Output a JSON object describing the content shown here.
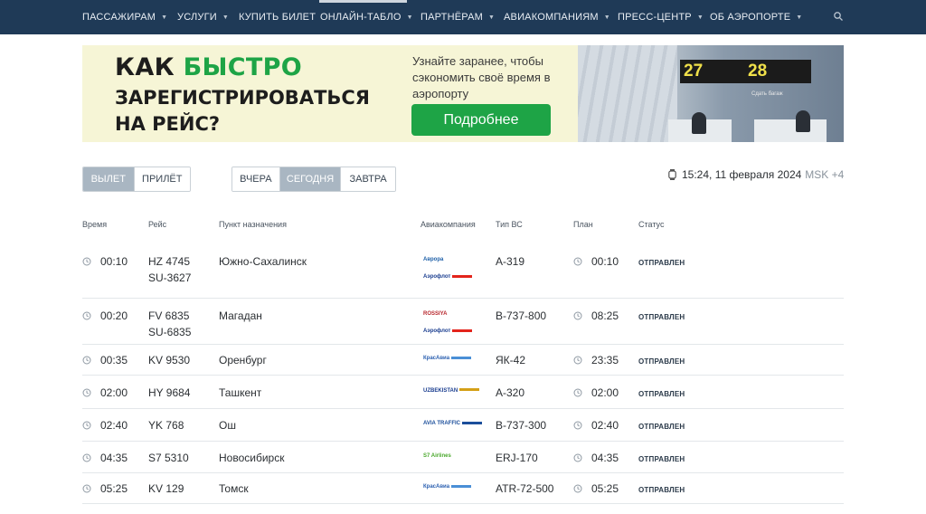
{
  "nav": {
    "items": [
      {
        "label": "ПАССАЖИРАМ",
        "caret": true
      },
      {
        "label": "УСЛУГИ",
        "caret": true
      },
      {
        "label": "КУПИТЬ БИЛЕТ",
        "caret": false
      },
      {
        "label": "ОНЛАЙН-ТАБЛО",
        "caret": true
      },
      {
        "label": "ПАРТНЁРАМ",
        "caret": true
      },
      {
        "label": "АВИАКОМПАНИЯМ",
        "caret": true
      },
      {
        "label": "ПРЕСС-ЦЕНТР",
        "caret": true
      },
      {
        "label": "ОБ АЭРОПОРТЕ",
        "caret": true
      }
    ],
    "search_icon": "search-icon"
  },
  "banner": {
    "title_part1": "КАК",
    "title_part2": "БЫСТРО",
    "title_line2": "ЗАРЕГИСТРИРОВАТЬСЯ",
    "title_line3": "НА РЕЙС?",
    "subtitle": "Узнайте заранее, чтобы сэкономить своё время в аэропорту",
    "button": "Подробнее",
    "sign1_number": "27",
    "sign2_number": "28",
    "sign2_text": "Сдать багаж",
    "accent_color": "#1ea446"
  },
  "filters": {
    "direction": [
      {
        "label": "ВЫЛЕТ",
        "active": true
      },
      {
        "label": "ПРИЛЁТ",
        "active": false
      }
    ],
    "day": [
      {
        "label": "ВЧЕРА",
        "active": false
      },
      {
        "label": "СЕГОДНЯ",
        "active": true
      },
      {
        "label": "ЗАВТРА",
        "active": false
      }
    ]
  },
  "clock": {
    "datetime": "15:24, 11 февраля 2024",
    "tz": "MSK +4"
  },
  "table": {
    "headers": [
      "Время",
      "Рейс",
      "Пункт назначения",
      "Авиакомпания",
      "Тип ВС",
      "План",
      "Статус"
    ],
    "rows": [
      {
        "time": "00:10",
        "flight": "HZ 4745",
        "flight2": "SU-3627",
        "destination": "Южно-Сахалинск",
        "airline": "Аврора",
        "airline2": "Аэрофлот",
        "aircraft": "A-319",
        "plan": "00:10",
        "status": "ОТПРАВЛЕН"
      },
      {
        "time": "00:20",
        "flight": "FV 6835",
        "flight2": "SU-6835",
        "destination": "Магадан",
        "airline": "ROSSIYA",
        "airline2": "Аэрофлот",
        "aircraft": "B-737-800",
        "plan": "08:25",
        "status": "ОТПРАВЛЕН"
      },
      {
        "time": "00:35",
        "flight": "KV 9530",
        "flight2": "",
        "destination": "Оренбург",
        "airline": "КрасАвиа",
        "airline2": "",
        "aircraft": "ЯК-42",
        "plan": "23:35",
        "status": "ОТПРАВЛЕН"
      },
      {
        "time": "02:00",
        "flight": "HY 9684",
        "flight2": "",
        "destination": "Ташкент",
        "airline": "UZBEKISTAN",
        "airline2": "",
        "aircraft": "A-320",
        "plan": "02:00",
        "status": "ОТПРАВЛЕН"
      },
      {
        "time": "02:40",
        "flight": "YK 768",
        "flight2": "",
        "destination": "Ош",
        "airline": "AVIA TRAFFIC",
        "airline2": "",
        "aircraft": "B-737-300",
        "plan": "02:40",
        "status": "ОТПРАВЛЕН"
      },
      {
        "time": "04:35",
        "flight": "S7 5310",
        "flight2": "",
        "destination": "Новосибирск",
        "airline": "S7 Airlines",
        "airline2": "",
        "aircraft": "ERJ-170",
        "plan": "04:35",
        "status": "ОТПРАВЛЕН"
      },
      {
        "time": "05:25",
        "flight": "KV 129",
        "flight2": "",
        "destination": "Томск",
        "airline": "КрасАвиа",
        "airline2": "",
        "aircraft": "ATR-72-500",
        "plan": "05:25",
        "status": "ОТПРАВЛЕН"
      }
    ]
  }
}
